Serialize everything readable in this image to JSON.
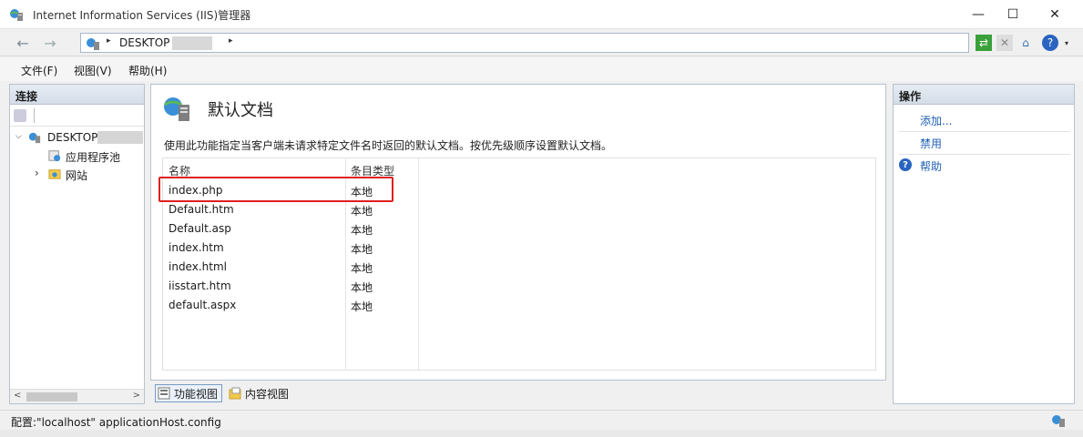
{
  "window": {
    "title": "Internet Information Services (IIS)管理器",
    "minimize_glyph": "—",
    "maximize_glyph": "☐",
    "close_glyph": "✕"
  },
  "nav": {
    "back_glyph": "←",
    "forward_glyph": "→",
    "breadcrumb": "DESKTOP",
    "arrow_glyph": "▸"
  },
  "menu": {
    "file": "文件(F)",
    "view": "视图(V)",
    "help": "帮助(H)"
  },
  "connections": {
    "header": "连接",
    "server": "DESKTOP",
    "app_pools": "应用程序池",
    "sites": "网站",
    "expanded_glyph": "⌵",
    "collapsed_glyph": "›",
    "scroll_left": "<",
    "scroll_right": ">"
  },
  "content": {
    "title": "默认文档",
    "description": "使用此功能指定当客户端未请求特定文件名时返回的默认文档。按优先级顺序设置默认文档。",
    "columns": {
      "name": "名称",
      "type": "条目类型"
    },
    "rows": [
      {
        "name": "index.php",
        "type": "本地"
      },
      {
        "name": "Default.htm",
        "type": "本地"
      },
      {
        "name": "Default.asp",
        "type": "本地"
      },
      {
        "name": "index.htm",
        "type": "本地"
      },
      {
        "name": "index.html",
        "type": "本地"
      },
      {
        "name": "iisstart.htm",
        "type": "本地"
      },
      {
        "name": "default.aspx",
        "type": "本地"
      }
    ],
    "highlighted_row": 0
  },
  "views": {
    "features": "功能视图",
    "content": "内容视图"
  },
  "actions": {
    "header": "操作",
    "add": "添加...",
    "disable": "禁用",
    "help": "帮助",
    "help_glyph": "?"
  },
  "status": {
    "text": "配置:\"localhost\" applicationHost.config"
  },
  "colors": {
    "link": "#1f5fb4",
    "highlight_border": "#e02020",
    "panel_border": "#b8c2cc"
  }
}
